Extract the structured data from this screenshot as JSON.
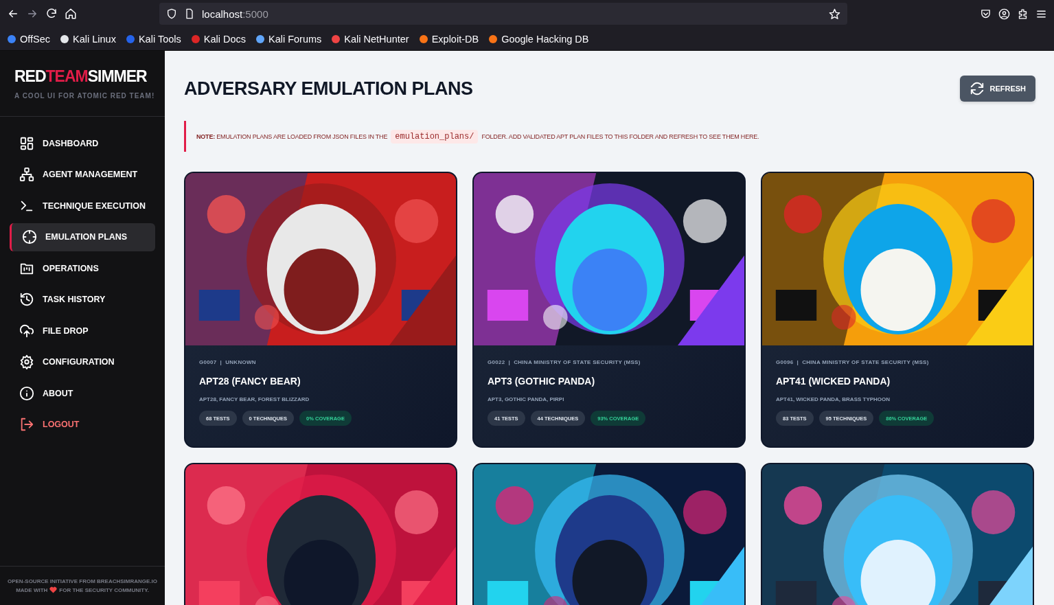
{
  "browser": {
    "address_host": "localhost",
    "address_port": ":5000",
    "bookmarks": [
      "OffSec",
      "Kali Linux",
      "Kali Tools",
      "Kali Docs",
      "Kali Forums",
      "Kali NetHunter",
      "Exploit-DB",
      "Google Hacking DB"
    ]
  },
  "sidebar": {
    "logo": [
      {
        "text": "RED",
        "accent": false
      },
      {
        "text": "TEAM",
        "accent": true
      },
      {
        "text": "SIMMER",
        "accent": false
      }
    ],
    "tagline": "A COOL UI FOR ATOMIC RED TEAM!",
    "items": [
      {
        "label": "DASHBOARD",
        "selected": false,
        "kind": "normal"
      },
      {
        "label": "AGENT MANAGEMENT",
        "selected": false,
        "kind": "normal"
      },
      {
        "label": "TECHNIQUE EXECUTION",
        "selected": false,
        "kind": "normal"
      },
      {
        "label": "EMULATION PLANS",
        "selected": true,
        "kind": "normal"
      },
      {
        "label": "OPERATIONS",
        "selected": false,
        "kind": "normal"
      },
      {
        "label": "TASK HISTORY",
        "selected": false,
        "kind": "normal"
      },
      {
        "label": "FILE DROP",
        "selected": false,
        "kind": "normal"
      },
      {
        "label": "CONFIGURATION",
        "selected": false,
        "kind": "normal"
      },
      {
        "label": "ABOUT",
        "selected": false,
        "kind": "normal"
      },
      {
        "label": "LOGOUT",
        "selected": false,
        "kind": "danger"
      }
    ],
    "footer": {
      "line_1": "OPEN-SOURCE INITIATIVE FROM BREACHSIMRANGE.IO",
      "line_2_before": "MADE WITH",
      "line_2_after": "FOR THE SECURITY COMMUNITY."
    }
  },
  "main": {
    "title": "ADVERSARY EMULATION PLANS",
    "refresh_button": "REFRESH",
    "note": {
      "before": "**NOTE:** EMULATION PLANS ARE LOADED FROM JSON FILES IN THE",
      "code": "emulation_plans/",
      "after": "FOLDER. ADD VALIDATED APT PLAN FILES TO THIS FOLDER AND REFRESH TO SEE THEM HERE."
    },
    "plans": [
      {
        "kind": "plan",
        "id": "G0007",
        "separator": "|",
        "origin": "UNKNOWN",
        "name": "APT28 (FANCY BEAR)",
        "aliases": "APT28, FANCY BEAR, FOREST BLIZZARD",
        "tests": "68 TESTS",
        "techniques": "0 TECHNIQUES",
        "coverage": "0% COVERAGE"
      },
      {
        "kind": "plan",
        "id": "G0022",
        "separator": "|",
        "origin": "CHINA MINISTRY OF STATE SECURITY (MSS)",
        "name": "APT3 (GOTHIC PANDA)",
        "aliases": "APT3, GOTHIC PANDA, PIRPI",
        "tests": "41 TESTS",
        "techniques": "44 TECHNIQUES",
        "coverage": "93% COVERAGE"
      },
      {
        "kind": "plan",
        "id": "G0096",
        "separator": "|",
        "origin": "CHINA MINISTRY OF STATE SECURITY (MSS)",
        "name": "APT41 (WICKED PANDA)",
        "aliases": "APT41, WICKED PANDA, BRASS TYPHOON",
        "tests": "83 TESTS",
        "techniques": "95 TECHNIQUES",
        "coverage": "86% COVERAGE"
      },
      {
        "kind": "picture"
      },
      {
        "kind": "picture"
      },
      {
        "kind": "picture"
      }
    ]
  }
}
